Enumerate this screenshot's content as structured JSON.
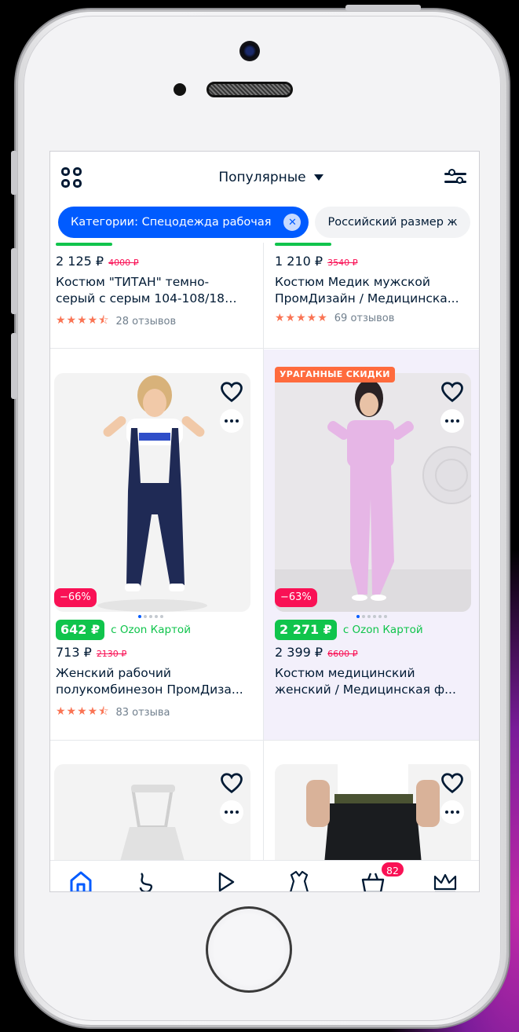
{
  "header": {
    "sort_label": "Популярные"
  },
  "chips": [
    {
      "label": "Категории: Спецодежда рабочая",
      "close": "✕"
    },
    {
      "label": "Российский размер ж"
    }
  ],
  "products_top": [
    {
      "price": "2 125 ₽",
      "old_price": "4000 ₽",
      "title_l1": "Костюм \"ТИТАН\" темно-",
      "title_l2": "серый с серым 104-108/182-...",
      "rating_stars": 4.5,
      "reviews": "28 отзывов"
    },
    {
      "price": "1 210 ₽",
      "old_price": "3540 ₽",
      "title_l1": "Костюм Медик мужской",
      "title_l2": "ПромДизайн / Медицинска...",
      "rating_stars": 5,
      "reviews": "69 отзывов"
    }
  ],
  "products_mid": [
    {
      "discount": "−66%",
      "ozon_price": "642 ₽",
      "ozon_card": "с Ozon Картой",
      "price": "713 ₽",
      "old_price": "2130 ₽",
      "title_l1": "Женский рабочий",
      "title_l2": "полукомбинезон ПромДиза...",
      "rating_stars": 4.5,
      "reviews": "83 отзыва",
      "photos": 5,
      "photo_index": 0
    },
    {
      "promo": "УРАГАННЫЕ СКИДКИ",
      "discount": "−63%",
      "ozon_price": "2 271 ₽",
      "ozon_card": "с Ozon Картой",
      "price": "2 399 ₽",
      "old_price": "6600 ₽",
      "title_l1": "Костюм медицинский",
      "title_l2": "женский / Медицинская ф...",
      "photos": 6,
      "photo_index": 0
    }
  ],
  "tabbar": {
    "cart_count": "82"
  },
  "colors": {
    "brand_blue": "#005bff",
    "ozon_green": "#10c44c",
    "discount_red": "#f91155",
    "star_orange": "#fa7454",
    "text_dark": "#001a34"
  }
}
